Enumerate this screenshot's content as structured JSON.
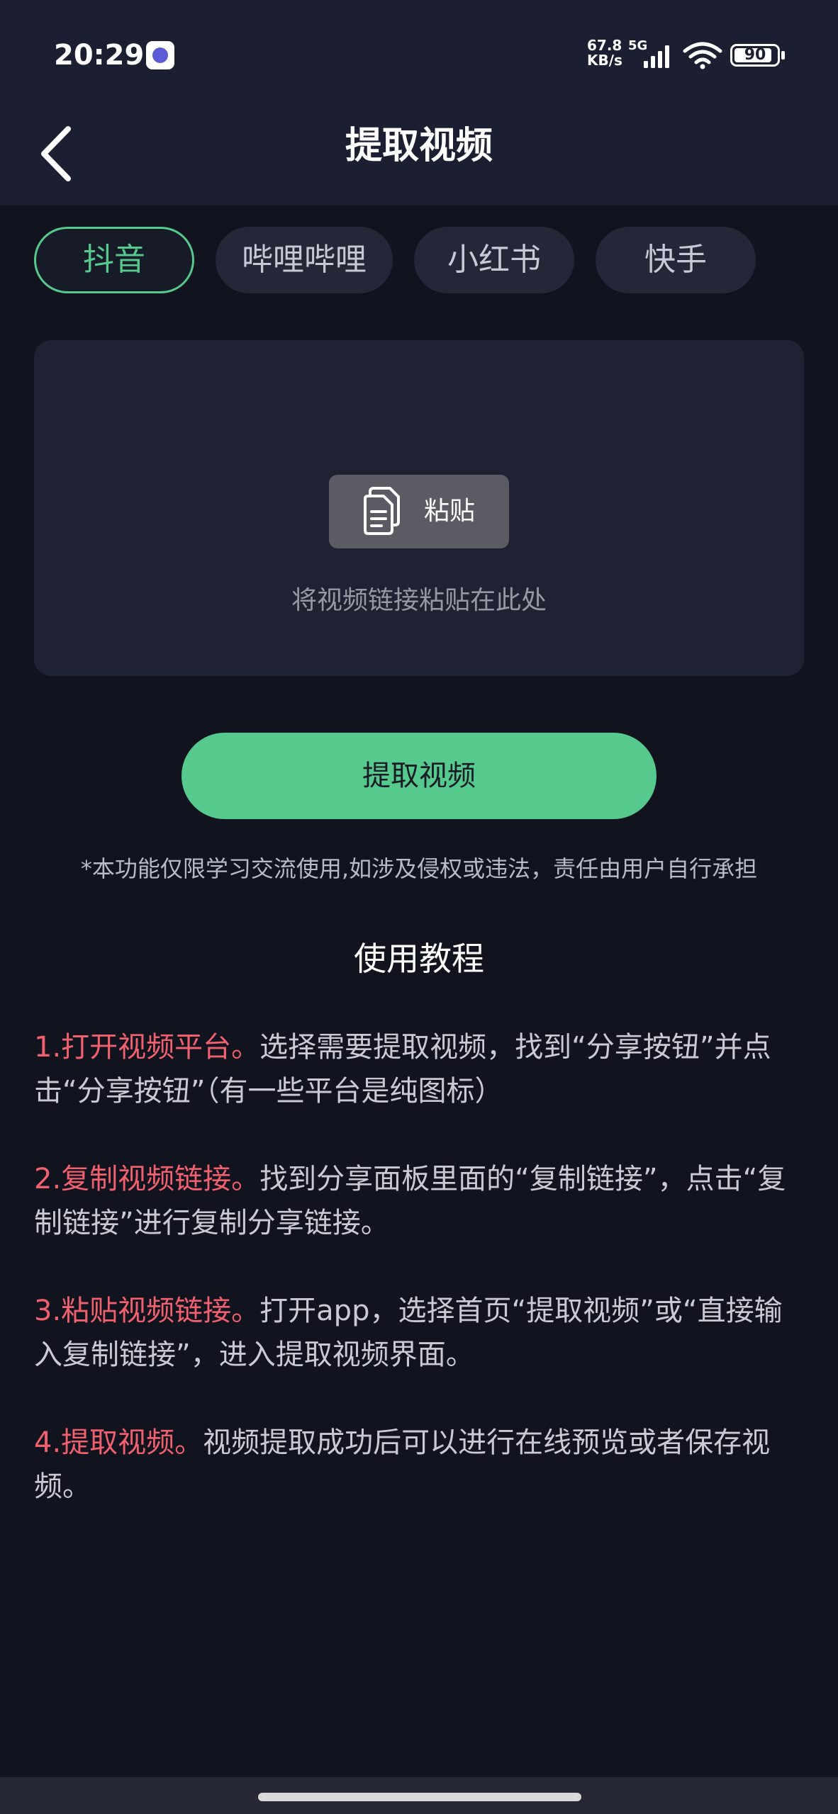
{
  "status_bar": {
    "time": "20:29",
    "net_speed_value": "67.8",
    "net_speed_unit": "KB/s",
    "network_type": "5G",
    "battery_level": 90,
    "battery_text": "90",
    "app_icon": "app-notification-icon",
    "signal_icon": "signal-bars-icon",
    "wifi_icon": "wifi-icon"
  },
  "header": {
    "back_icon": "chevron-left-icon",
    "title": "提取视频"
  },
  "tabs": [
    {
      "label": "抖音",
      "active": true
    },
    {
      "label": "哔哩哔哩",
      "active": false
    },
    {
      "label": "小红书",
      "active": false
    },
    {
      "label": "快手",
      "active": false
    }
  ],
  "paste_area": {
    "button_icon": "clipboard-icon",
    "button_label": "粘贴",
    "hint": "将视频链接粘贴在此处"
  },
  "extract_button": {
    "label": "提取视频"
  },
  "disclaimer": "*本功能仅限学习交流使用,如涉及侵权或违法，责任由用户自行承担",
  "tutorial": {
    "title": "使用教程",
    "steps": [
      {
        "number": "1.",
        "highlight": "打开视频平台。",
        "text": "选择需要提取视频，找到“分享按钮”并点击“分享按钮”（有一些平台是纯图标）"
      },
      {
        "number": "2.",
        "highlight": "复制视频链接。",
        "text": "找到分享面板里面的“复制链接”，点击“复制链接”进行复制分享链接。"
      },
      {
        "number": "3.",
        "highlight": "粘贴视频链接。",
        "text": "打开app，选择首页“提取视频”或“直接输入复制链接”，进入提取视频界面。"
      },
      {
        "number": "4.",
        "highlight": "提取视频。",
        "text": "视频提取成功后可以进行在线预览或者保存视频。"
      }
    ]
  },
  "colors": {
    "background": "#11131f",
    "header_background": "#1c1f31",
    "accent_green": "#56c98c",
    "highlight_red": "#f0606d",
    "card_background": "#1f2232"
  }
}
